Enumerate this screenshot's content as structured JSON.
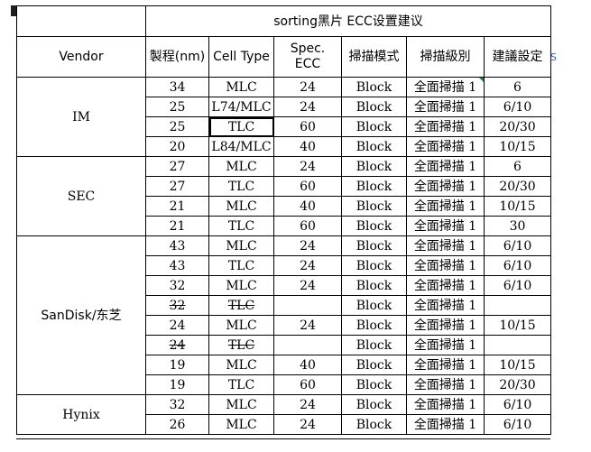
{
  "title": "sorting黑片 ECC设置建议",
  "headers": [
    "Vendor",
    "製程(nm)",
    "Cell Type",
    "Spec. ECC",
    "掃描模式",
    "掃描級別",
    "建議設定"
  ],
  "spill_text": "S",
  "vendors": [
    {
      "name": "IM",
      "rows": [
        {
          "process": "34",
          "cell": "MLC",
          "ecc": "24",
          "mode": "Block",
          "level": "全面掃描 1",
          "setting": "6"
        },
        {
          "process": "25",
          "cell": "L74/MLC",
          "ecc": "24",
          "mode": "Block",
          "level": "全面掃描 1",
          "setting": "6/10"
        },
        {
          "process": "25",
          "cell": "TLC",
          "ecc": "60",
          "mode": "Block",
          "level": "全面掃描 1",
          "setting": "20/30"
        },
        {
          "process": "20",
          "cell": "L84/MLC",
          "ecc": "40",
          "mode": "Block",
          "level": "全面掃描 1",
          "setting": "10/15"
        }
      ]
    },
    {
      "name": "SEC",
      "rows": [
        {
          "process": "27",
          "cell": "MLC",
          "ecc": "24",
          "mode": "Block",
          "level": "全面掃描 1",
          "setting": "6"
        },
        {
          "process": "27",
          "cell": "TLC",
          "ecc": "60",
          "mode": "Block",
          "level": "全面掃描 1",
          "setting": "20/30"
        },
        {
          "process": "21",
          "cell": "MLC",
          "ecc": "40",
          "mode": "Block",
          "level": "全面掃描 1",
          "setting": "10/15"
        },
        {
          "process": "21",
          "cell": "TLC",
          "ecc": "60",
          "mode": "Block",
          "level": "全面掃描 1",
          "setting": "30"
        }
      ]
    },
    {
      "name": "SanDisk/东芝",
      "rows": [
        {
          "process": "43",
          "cell": "MLC",
          "ecc": "24",
          "mode": "Block",
          "level": "全面掃描 1",
          "setting": "6/10"
        },
        {
          "process": "43",
          "cell": "TLC",
          "ecc": "24",
          "mode": "Block",
          "level": "全面掃描 1",
          "setting": "6/10"
        },
        {
          "process": "32",
          "cell": "MLC",
          "ecc": "24",
          "mode": "Block",
          "level": "全面掃描 1",
          "setting": "6/10"
        },
        {
          "process": "32",
          "cell": "TLC",
          "ecc": "",
          "mode": "Block",
          "level": "全面掃描 1",
          "setting": "",
          "strike": true
        },
        {
          "process": "24",
          "cell": "MLC",
          "ecc": "24",
          "mode": "Block",
          "level": "全面掃描 1",
          "setting": "10/15"
        },
        {
          "process": "24",
          "cell": "TLC",
          "ecc": "",
          "mode": "Block",
          "level": "全面掃描 1",
          "setting": "",
          "strike": true
        },
        {
          "process": "19",
          "cell": "MLC",
          "ecc": "40",
          "mode": "Block",
          "level": "全面掃描 1",
          "setting": "10/15"
        },
        {
          "process": "19",
          "cell": "TLC",
          "ecc": "60",
          "mode": "Block",
          "level": "全面掃描 1",
          "setting": "20/30"
        }
      ]
    },
    {
      "name": "Hynix",
      "rows": [
        {
          "process": "32",
          "cell": "MLC",
          "ecc": "24",
          "mode": "Block",
          "level": "全面掃描 1",
          "setting": "6/10"
        },
        {
          "process": "26",
          "cell": "MLC",
          "ecc": "24",
          "mode": "Block",
          "level": "全面掃描 1",
          "setting": "6/10"
        }
      ]
    }
  ]
}
